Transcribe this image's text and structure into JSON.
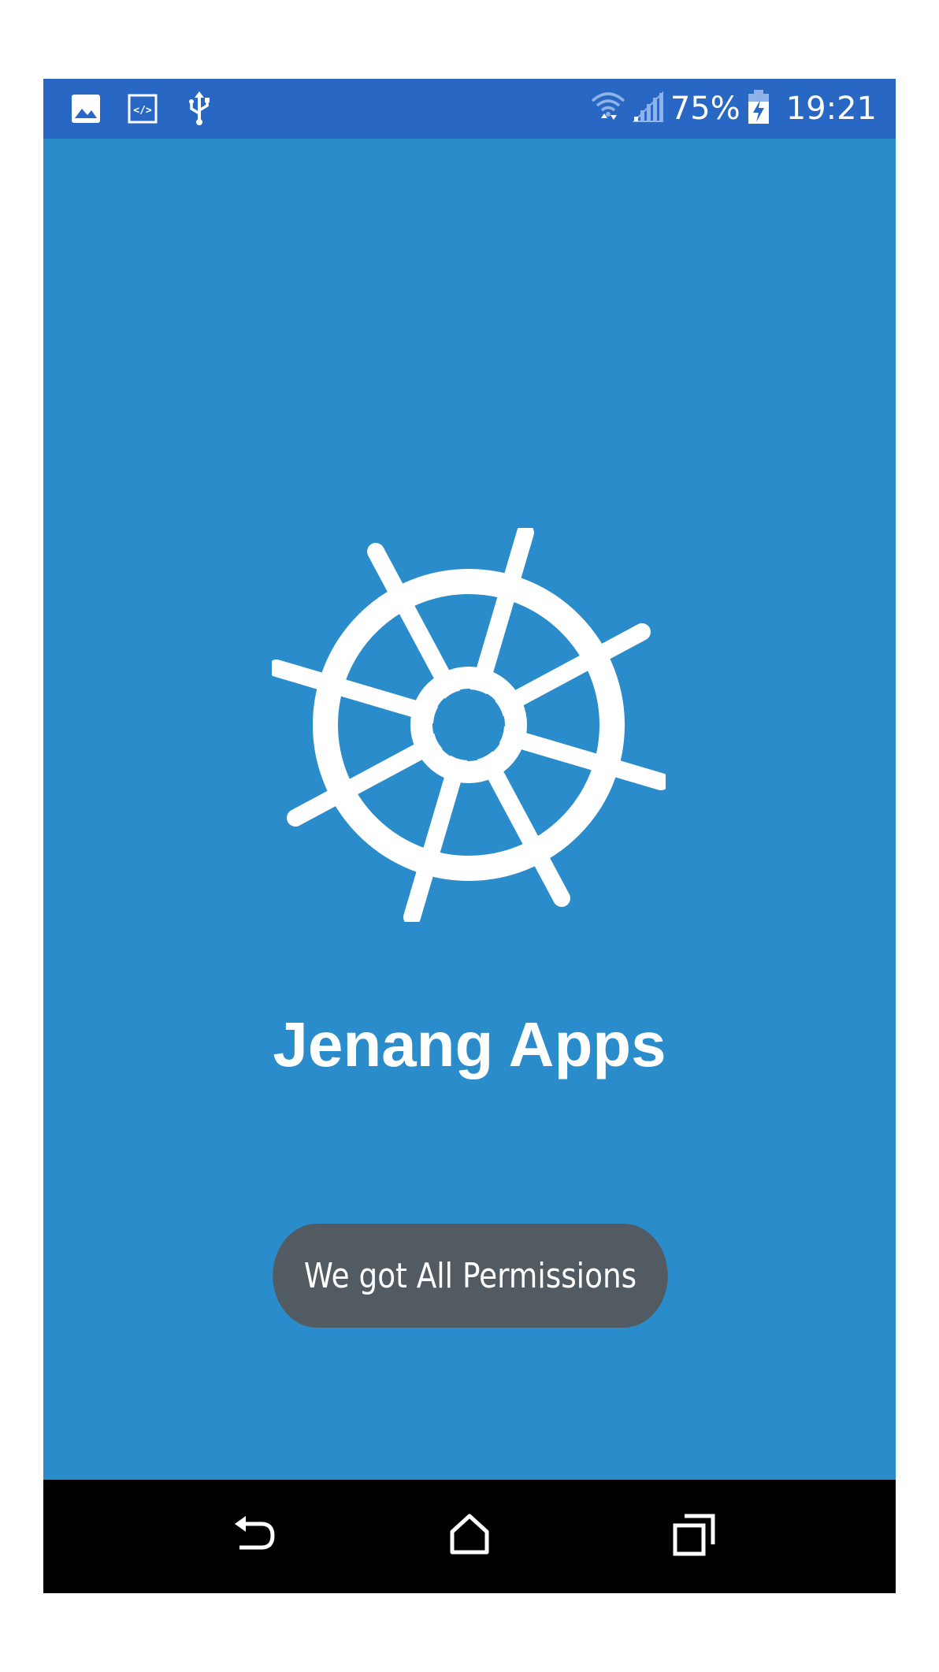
{
  "status_bar": {
    "left_icons": [
      "gallery-icon",
      "code-icon",
      "usb-icon"
    ],
    "right_icons": [
      "wifi-icon",
      "signal-icon",
      "battery-charging-icon"
    ],
    "battery_percent": "75%",
    "time": "19:21",
    "color": "#2867c4"
  },
  "splash": {
    "logo_icon": "ship-wheel-icon",
    "app_name": "Jenang Apps",
    "background_color": "#2a8ccb"
  },
  "toast": {
    "message": "We got All Permissions",
    "color": "#535b62"
  },
  "nav_bar": {
    "buttons": [
      "back-icon",
      "home-icon",
      "recents-icon"
    ]
  }
}
